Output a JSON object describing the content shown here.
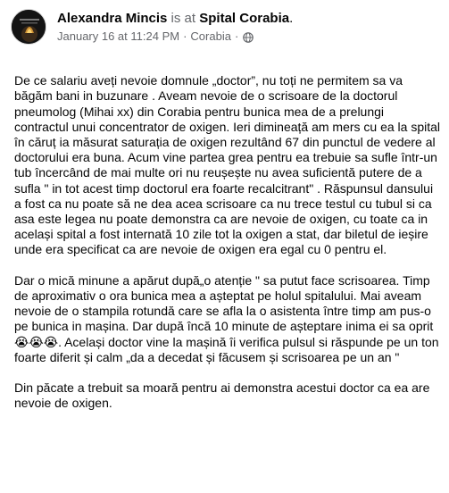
{
  "post": {
    "author": "Alexandra Mincis",
    "connector": " is at ",
    "place": "Spital Corabia",
    "place_suffix": ".",
    "date": "January 16 at 11:24 PM",
    "separator": "·",
    "location": "Corabia",
    "separator2": "·",
    "privacy_icon": "globe-icon",
    "paragraphs": [
      "De ce salariu aveți nevoie domnule „doctor”, nu toți ne permitem sa va băgăm bani in buzunare . Aveam nevoie de o scrisoare de la doctorul pneumolog (Mihai xx) din Corabia pentru bunica mea de a prelungi contractul unui concentrator de oxigen. Ieri dimineață am mers cu ea la spital în căruț ia măsurat saturația de oxigen rezultând 67 din punctul de vedere al doctorului era buna. Acum vine partea grea pentru ea trebuie sa sufle într-un tub încercând de mai multe ori nu reușește nu avea suficientă putere de a sufla \" in tot acest timp doctorul era foarte recalcitrant\" . Răspunsul dansului a fost ca nu poate să ne dea acea scrisoare ca nu trece testul cu tubul si ca asa este legea nu poate demonstra ca are nevoie de oxigen, cu toate ca in același spital a fost internată 10 zile tot la oxigen a stat, dar biletul de ieșire unde era specificat ca are nevoie de oxigen era egal cu 0 pentru el.",
      "Dar o mică minune a apărut după„o atenție \" sa putut face scrisoarea. Timp de aproximativ o ora bunica mea a așteptat pe holul spitalului. Mai aveam nevoie de o stampila rotundă care se afla la o asistenta între timp am pus-o pe bunica in mașina. Dar după încă 10 minute de așteptare inima ei sa oprit 😭😭😭. Același doctor vine la mașină îi verifica pulsul si răspunde pe un ton foarte diferit și calm „da a decedat și făcusem și scrisoarea pe un an \"",
      "Din  păcate a trebuit sa moară pentru ai demonstra acestui doctor ca ea are nevoie de oxigen."
    ]
  }
}
